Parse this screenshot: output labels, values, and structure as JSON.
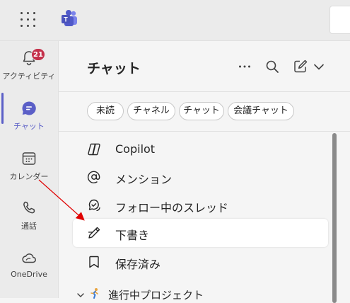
{
  "rail": {
    "activity": {
      "label": "アクティビティ",
      "badge": "21"
    },
    "chat": {
      "label": "チャット"
    },
    "calendar": {
      "label": "カレンダー"
    },
    "calls": {
      "label": "通話"
    },
    "onedrive": {
      "label": "OneDrive"
    }
  },
  "panel": {
    "title": "チャット",
    "filters": [
      "未読",
      "チャネル",
      "チャット",
      "会議チャット"
    ],
    "items": [
      {
        "label": "Copilot",
        "icon": "copilot-icon"
      },
      {
        "label": "メンション",
        "icon": "at-sign-icon"
      },
      {
        "label": "フォロー中のスレッド",
        "icon": "thread-bubble-icon"
      },
      {
        "label": "下書き",
        "icon": "pencil-icon"
      },
      {
        "label": "保存済み",
        "icon": "bookmark-icon"
      }
    ],
    "section": {
      "label": "進行中プロジェクト"
    }
  },
  "colors": {
    "accent": "#5b5fc7",
    "badge": "#c4314b",
    "annotation_arrow": "#e00000"
  }
}
